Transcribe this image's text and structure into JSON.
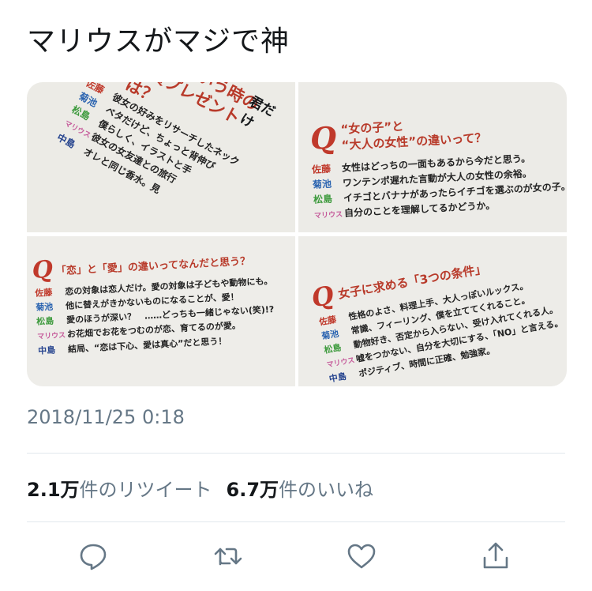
{
  "tweet": {
    "text": "マリウスがマジで神",
    "timestamp": "2018/11/25 0:18",
    "retweets": {
      "count": "2.1万",
      "label": "件のリツイート"
    },
    "likes": {
      "count": "6.7万",
      "label": "件のいいね"
    }
  },
  "photos": {
    "p1": {
      "title_lines": [
        "ここぞという時の",
        "勝負プレゼントは？"
      ],
      "corner": "君だけ",
      "names": [
        "佐藤",
        "菊池",
        "松島",
        "マリウス",
        "中島"
      ],
      "lines": [
        "彼女の好みをリサーチしたネック",
        "ベタだけど、ちょっと背伸び",
        "僕らしく、イラストと手",
        "彼女の女友達との旅行",
        "オレと同じ香水。見"
      ]
    },
    "p2": {
      "q": "Q",
      "title_lines": [
        "“女の子”と",
        "“大人の女性”の違いって？"
      ],
      "rows": [
        {
          "name": "佐藤",
          "text": "女性はどっちの一面もあるから今だと思う。"
        },
        {
          "name": "菊池",
          "text": "ワンテンポ遅れた言動が大人の女性の余裕。"
        },
        {
          "name": "松島",
          "text": "イチゴとバナナがあったらイチゴを選ぶのが女の子。"
        },
        {
          "name": "マリウス",
          "text": "自分のことを理解してるかどうか。"
        }
      ]
    },
    "p3": {
      "q": "Q",
      "title": "「恋」と「愛」の違いってなんだと思う？",
      "rows": [
        {
          "name": "佐藤",
          "text": "恋の対象は恋人だけ。愛の対象は子どもや動物にも。"
        },
        {
          "name": "菊池",
          "text": "他に替えがきかないものになることが、愛！"
        },
        {
          "name": "松島",
          "text": "愛のほうが深い？　……どっちも一緒じゃない(笑)!?"
        },
        {
          "name": "マリウス",
          "text": "お花畑でお花をつむのが恋、育てるのが愛。"
        },
        {
          "name": "中島",
          "text": "結局、“恋は下心、愛は真心”だと思う！"
        }
      ]
    },
    "p4": {
      "q": "Q",
      "title": "女子に求める「3つの条件」",
      "rows": [
        {
          "name": "佐藤",
          "text": "性格のよさ、料理上手、大人っぽいルックス。"
        },
        {
          "name": "菊池",
          "text": "常識、フィーリング、僕を立ててくれること。"
        },
        {
          "name": "松島",
          "text": "動物好き、否定から入らない、受け入れてくれる人。"
        },
        {
          "name": "マリウス",
          "text": "嘘をつかない、自分を大切にする、「NO」と言える。"
        },
        {
          "name": "中島",
          "text": "ポジティブ、時間に正確、勉強家。"
        }
      ]
    }
  },
  "actions": {
    "reply": "reply-icon",
    "retweet": "retweet-icon",
    "like": "heart-icon",
    "share": "share-icon"
  }
}
